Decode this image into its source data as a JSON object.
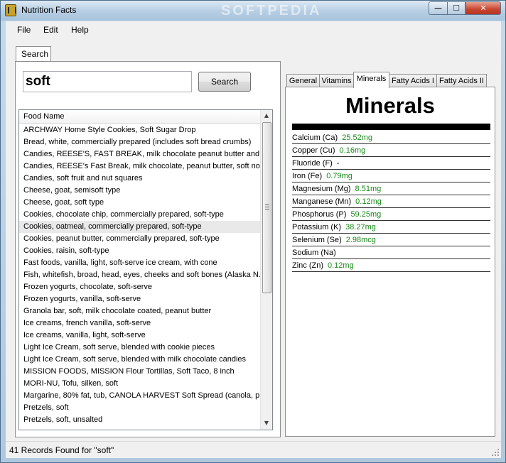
{
  "window": {
    "title": "Nutrition Facts",
    "watermark": "SOFTPEDIA",
    "controls": {
      "minimize": "—",
      "maximize": "☐",
      "close": "✕"
    }
  },
  "menu": [
    "File",
    "Edit",
    "Help"
  ],
  "search": {
    "tab_label": "Search",
    "query": "soft",
    "button_label": "Search",
    "column_header": "Food Name",
    "highlighted_index": 8,
    "scroll_position": 0.35,
    "results": [
      "ARCHWAY Home Style Cookies, Soft Sugar Drop",
      "Bread, white, commercially prepared (includes soft bread crumbs)",
      "Candies, REESE'S, FAST BREAK, milk chocolate peanut butter and...",
      "Candies, REESE's Fast Break, milk chocolate, peanut butter, soft no...",
      "Candies, soft fruit and nut squares",
      "Cheese, goat, semisoft type",
      "Cheese, goat, soft type",
      "Cookies, chocolate chip, commercially prepared, soft-type",
      "Cookies, oatmeal, commercially prepared, soft-type",
      "Cookies, peanut butter, commercially prepared, soft-type",
      "Cookies, raisin, soft-type",
      "Fast foods, vanilla, light, soft-serve ice cream, with cone",
      "Fish, whitefish, broad, head, eyes, cheeks and soft bones (Alaska N...",
      "Frozen yogurts, chocolate, soft-serve",
      "Frozen yogurts, vanilla, soft-serve",
      "Granola bar, soft, milk chocolate coated, peanut butter",
      "Ice creams, french vanilla, soft-serve",
      "Ice creams, vanilla, light, soft-serve",
      "Light Ice Cream, soft serve, blended with cookie pieces",
      "Light Ice Cream, soft serve, blended with milk chocolate candies",
      "MISSION FOODS, MISSION Flour Tortillas, Soft Taco, 8 inch",
      "MORI-NU, Tofu, silken, soft",
      "Margarine, 80% fat, tub, CANOLA HARVEST Soft Spread (canola, p...",
      "Pretzels, soft",
      "Pretzels, soft, unsalted"
    ]
  },
  "tabs": [
    "General",
    "Vitamins",
    "Minerals",
    "Fatty Acids I",
    "Fatty Acids II"
  ],
  "active_tab": "Minerals",
  "minerals": {
    "title": "Minerals",
    "rows": [
      {
        "name": "Calcium (Ca)",
        "value": "25.52mg"
      },
      {
        "name": "Copper (Cu)",
        "value": "0.16mg"
      },
      {
        "name": "Fluoride (F)",
        "value": "-"
      },
      {
        "name": "Iron (Fe)",
        "value": "0.79mg"
      },
      {
        "name": "Magnesium (Mg)",
        "value": "8.51mg"
      },
      {
        "name": "Manganese (Mn)",
        "value": "0.12mg"
      },
      {
        "name": "Phosphorus (P)",
        "value": "59.25mg"
      },
      {
        "name": "Potassium (K)",
        "value": "38.27mg"
      },
      {
        "name": "Selenium (Se)",
        "value": "2.98mcg"
      },
      {
        "name": "Sodium (Na)",
        "value": ""
      },
      {
        "name": "Zinc (Zn)",
        "value": "0.12mg"
      }
    ]
  },
  "status": {
    "text": "41 Records Found  for \"soft\""
  },
  "colors": {
    "value_green": "#1b8a1b",
    "row_highlight": "#e9e9e9",
    "close_red": "#c74530"
  }
}
